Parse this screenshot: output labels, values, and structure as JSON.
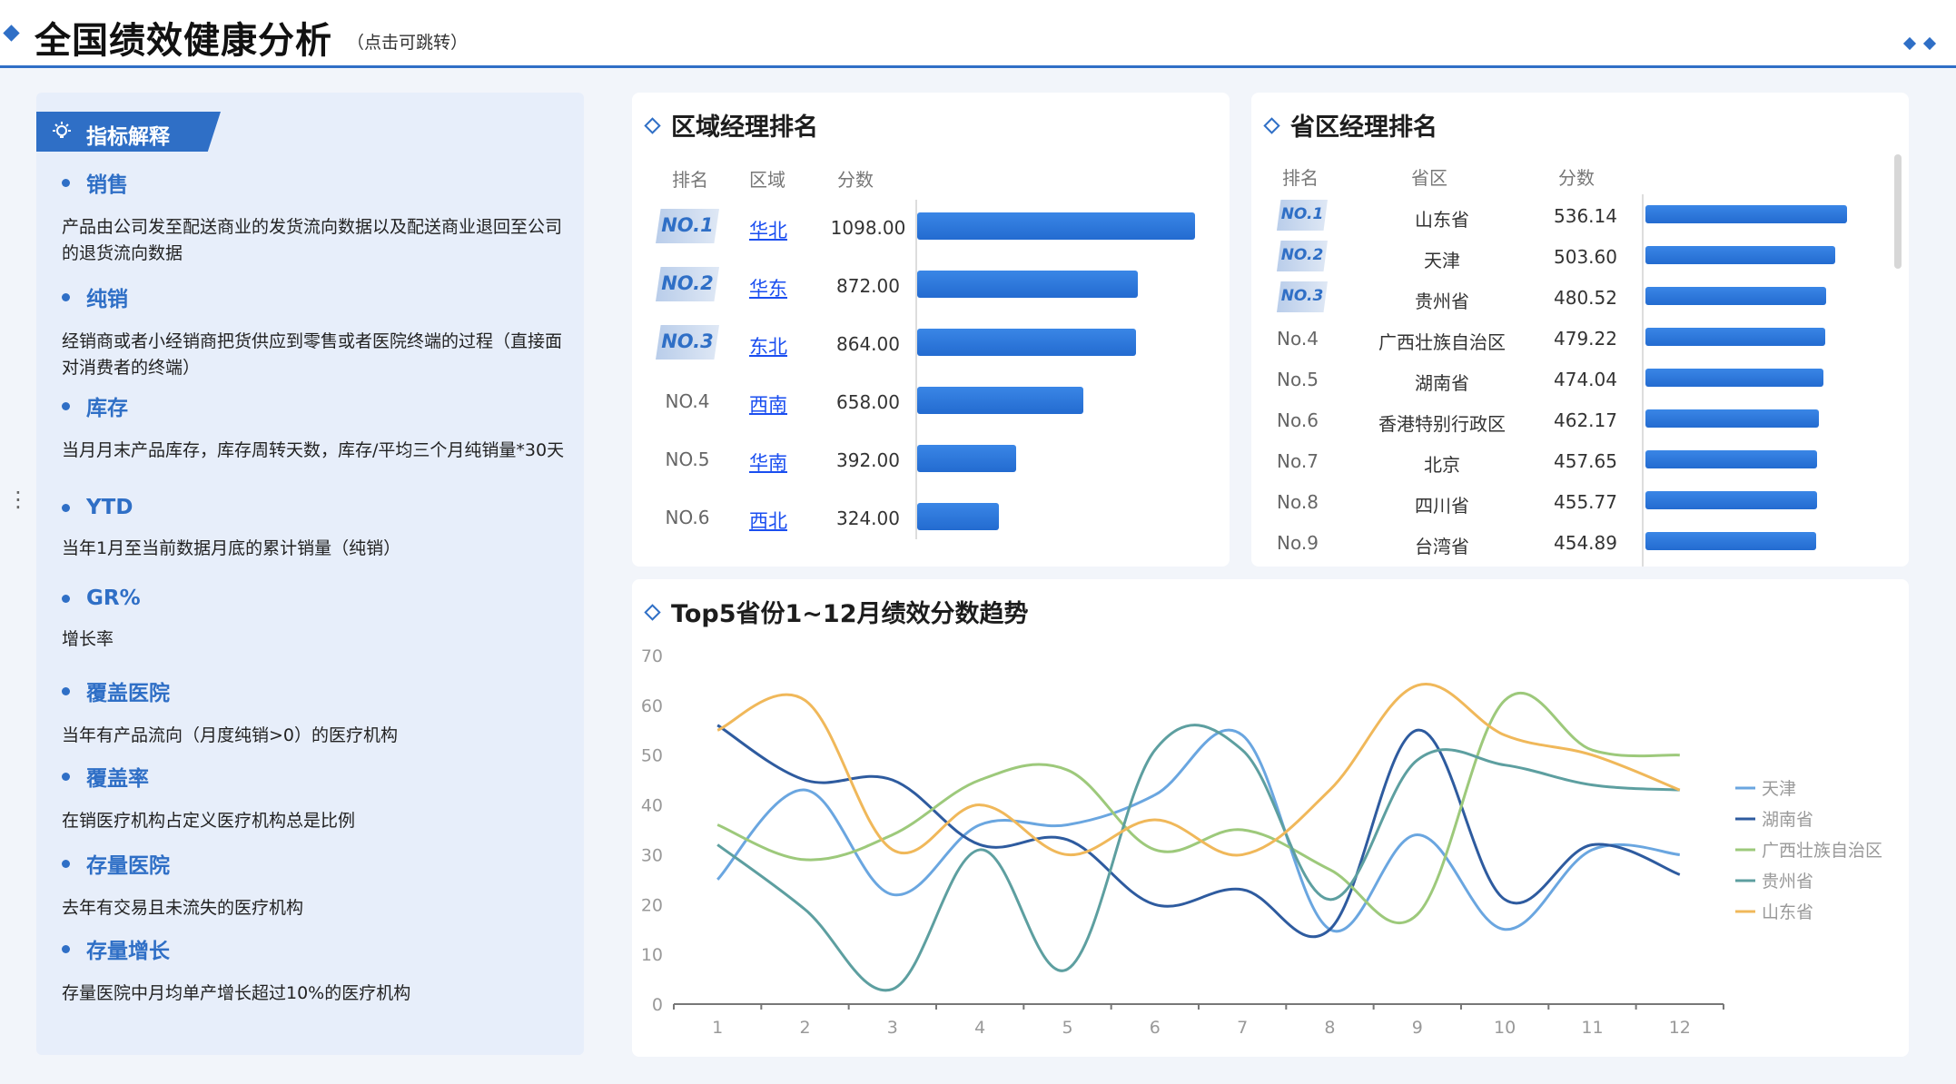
{
  "header": {
    "title": "全国绩效健康分析",
    "subtitle": "（点击可跳转）"
  },
  "explain": {
    "tag_label": "指标解释",
    "terms": [
      {
        "name": "销售",
        "desc": "产品由公司发至配送商业的发货流向数据以及配送商业退回至公司的退货流向数据"
      },
      {
        "name": "纯销",
        "desc": "经销商或者小经销商把货供应到零售或者医院终端的过程（直接面对消费者的终端）"
      },
      {
        "name": "库存",
        "desc": "当月月末产品库存，库存周转天数，库存/平均三个月纯销量*30天"
      },
      {
        "name": "YTD",
        "desc": "当年1月至当前数据月底的累计销量（纯销）"
      },
      {
        "name": "GR%",
        "desc": "增长率"
      },
      {
        "name": "覆盖医院",
        "desc": "当年有产品流向（月度纯销>0）的医疗机构"
      },
      {
        "name": "覆盖率",
        "desc": "在销医疗机构占定义医疗机构总是比例"
      },
      {
        "name": "存量医院",
        "desc": "去年有交易且未流失的医疗机构"
      },
      {
        "name": "存量增长",
        "desc": "存量医院中月均单产增长超过10%的医疗机构"
      }
    ]
  },
  "region_rank": {
    "title": "区域经理排名",
    "headers": {
      "rank": "排名",
      "region": "区域",
      "score": "分数"
    },
    "rows": [
      {
        "rank": "NO.1",
        "region": "华北",
        "score": "1098.00",
        "value": 1098
      },
      {
        "rank": "NO.2",
        "region": "华东",
        "score": "872.00",
        "value": 872
      },
      {
        "rank": "NO.3",
        "region": "东北",
        "score": "864.00",
        "value": 864
      },
      {
        "rank": "NO.4",
        "region": "西南",
        "score": "658.00",
        "value": 658
      },
      {
        "rank": "NO.5",
        "region": "华南",
        "score": "392.00",
        "value": 392
      },
      {
        "rank": "NO.6",
        "region": "西北",
        "score": "324.00",
        "value": 324
      }
    ]
  },
  "province_rank": {
    "title": "省区经理排名",
    "headers": {
      "rank": "排名",
      "province": "省区",
      "score": "分数"
    },
    "rows": [
      {
        "rank": "NO.1",
        "province": "山东省",
        "score": "536.14",
        "value": 536.14
      },
      {
        "rank": "NO.2",
        "province": "天津",
        "score": "503.60",
        "value": 503.6
      },
      {
        "rank": "NO.3",
        "province": "贵州省",
        "score": "480.52",
        "value": 480.52
      },
      {
        "rank": "No.4",
        "province": "广西壮族自治区",
        "score": "479.22",
        "value": 479.22
      },
      {
        "rank": "No.5",
        "province": "湖南省",
        "score": "474.04",
        "value": 474.04
      },
      {
        "rank": "No.6",
        "province": "香港特别行政区",
        "score": "462.17",
        "value": 462.17
      },
      {
        "rank": "No.7",
        "province": "北京",
        "score": "457.65",
        "value": 457.65
      },
      {
        "rank": "No.8",
        "province": "四川省",
        "score": "455.77",
        "value": 455.77
      },
      {
        "rank": "No.9",
        "province": "台湾省",
        "score": "454.89",
        "value": 454.89
      }
    ]
  },
  "trend": {
    "title": "Top5省份1~12月绩效分数趋势"
  },
  "chart_data": {
    "type": "line",
    "x": [
      "1",
      "2",
      "3",
      "4",
      "5",
      "6",
      "7",
      "8",
      "9",
      "10",
      "11",
      "12"
    ],
    "ylim": [
      0,
      70
    ],
    "yticks": [
      "0",
      "10",
      "20",
      "30",
      "40",
      "50",
      "60",
      "70"
    ],
    "grid": false,
    "legend": "right",
    "series": [
      {
        "name": "天津",
        "color": "#6aa6e0",
        "values": [
          25,
          43,
          22,
          36,
          36,
          42,
          54,
          15,
          34,
          15,
          31,
          30
        ]
      },
      {
        "name": "湖南省",
        "color": "#2e5b9f",
        "values": [
          56,
          45,
          45,
          32,
          33,
          20,
          23,
          15,
          55,
          21,
          32,
          26
        ]
      },
      {
        "name": "广西壮族自治区",
        "color": "#9dc97b",
        "values": [
          36,
          29,
          34,
          45,
          47,
          31,
          35,
          27,
          18,
          61,
          51,
          50
        ]
      },
      {
        "name": "贵州省",
        "color": "#5d9fa0",
        "values": [
          32,
          19,
          3,
          31,
          7,
          51,
          51,
          21,
          49,
          48,
          44,
          43
        ]
      },
      {
        "name": "山东省",
        "color": "#f0b85a",
        "values": [
          55,
          61,
          31,
          40,
          30,
          37,
          30,
          43,
          64,
          54,
          50,
          43
        ]
      }
    ]
  }
}
